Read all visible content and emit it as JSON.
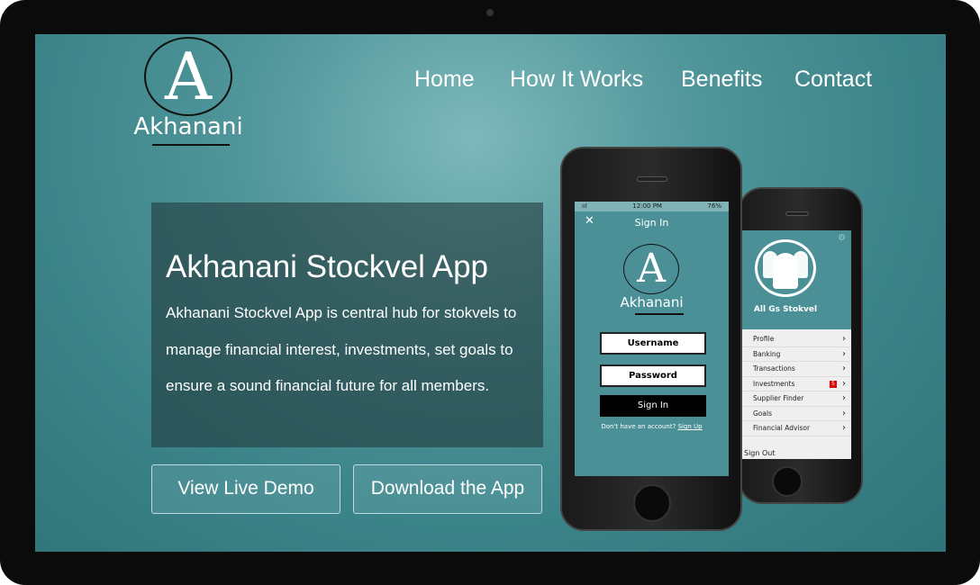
{
  "header": {
    "logo_letter": "A",
    "logo_text": "Akhanani",
    "nav": [
      "Home",
      "How It Works",
      "Benefits",
      "Contact"
    ]
  },
  "hero": {
    "title": "Akhanani Stockvel App",
    "description": "Akhanani Stockvel App is central hub for stokvels to manage financial interest, investments, set goals to ensure a sound financial future for all members."
  },
  "buttons": {
    "demo": "View Live Demo",
    "download": "Download the App"
  },
  "phone_signin": {
    "signal": "ııl",
    "time": "12:00 PM",
    "battery": "76%",
    "close": "✕",
    "title": "Sign In",
    "logo_letter": "A",
    "logo_text": "Akhanani",
    "username": "Username",
    "password": "Password",
    "signin": "Sign In",
    "no_account": "Don't have an account?",
    "signup": "Sign Up"
  },
  "phone_menu": {
    "group": "All Gs Stokvel",
    "items": [
      "Profile",
      "Banking",
      "Transactions",
      "Investments",
      "Supplier Finder",
      "Goals",
      "Financial Advisor"
    ],
    "badge": "5",
    "signout": "Sign Out"
  },
  "colors": {
    "teal": "#4a9096",
    "badge": "#e00000"
  }
}
